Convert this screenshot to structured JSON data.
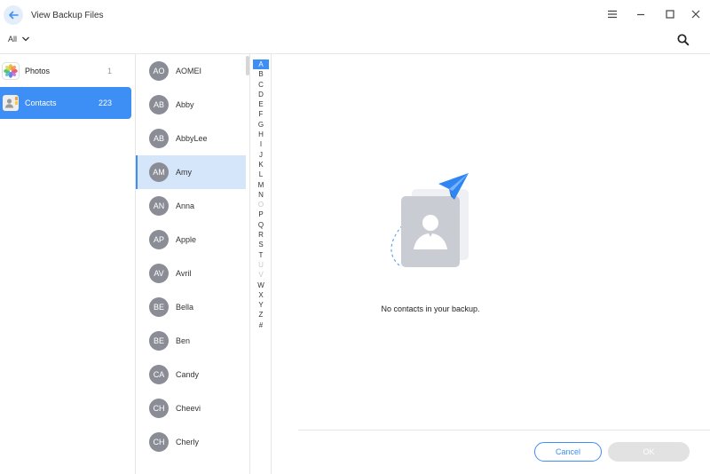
{
  "window": {
    "title": "View Backup Files",
    "icons": {
      "back": "arrow-left-icon",
      "menu": "hamburger-icon",
      "minimize": "minimize-icon",
      "maximize": "maximize-icon",
      "close": "close-icon"
    }
  },
  "filter": {
    "selected": "All",
    "search_icon": "search-icon"
  },
  "categories": [
    {
      "label": "Photos",
      "count": "1",
      "icon": "photos-icon",
      "active": false
    },
    {
      "label": "Contacts",
      "count": "223",
      "icon": "contacts-icon",
      "active": true
    }
  ],
  "contacts": [
    {
      "initials": "AO",
      "name": "AOMEI"
    },
    {
      "initials": "AB",
      "name": "Abby"
    },
    {
      "initials": "AB",
      "name": "AbbyLee"
    },
    {
      "initials": "AM",
      "name": "Amy",
      "selected": true
    },
    {
      "initials": "AN",
      "name": "Anna"
    },
    {
      "initials": "AP",
      "name": "Apple"
    },
    {
      "initials": "AV",
      "name": "Avril"
    },
    {
      "initials": "BE",
      "name": "Bella"
    },
    {
      "initials": "BE",
      "name": "Ben"
    },
    {
      "initials": "CA",
      "name": "Candy"
    },
    {
      "initials": "CH",
      "name": "Cheevi"
    },
    {
      "initials": "CH",
      "name": "Cherly"
    }
  ],
  "alphabet": [
    "A",
    "B",
    "C",
    "D",
    "E",
    "F",
    "G",
    "H",
    "I",
    "J",
    "K",
    "L",
    "M",
    "N",
    "O",
    "P",
    "Q",
    "R",
    "S",
    "T",
    "U",
    "V",
    "W",
    "X",
    "Y",
    "Z",
    "#"
  ],
  "alphabet_active": "A",
  "alphabet_disabled": [
    "O",
    "U",
    "V"
  ],
  "empty_state": {
    "message": "No contacts in your backup."
  },
  "footer": {
    "cancel_label": "Cancel",
    "ok_label": "OK"
  },
  "colors": {
    "accent": "#3d8ef5",
    "selected_row": "#d5e6fb",
    "avatar": "#8a8d96",
    "ok_disabled": "#e2e2e2"
  }
}
